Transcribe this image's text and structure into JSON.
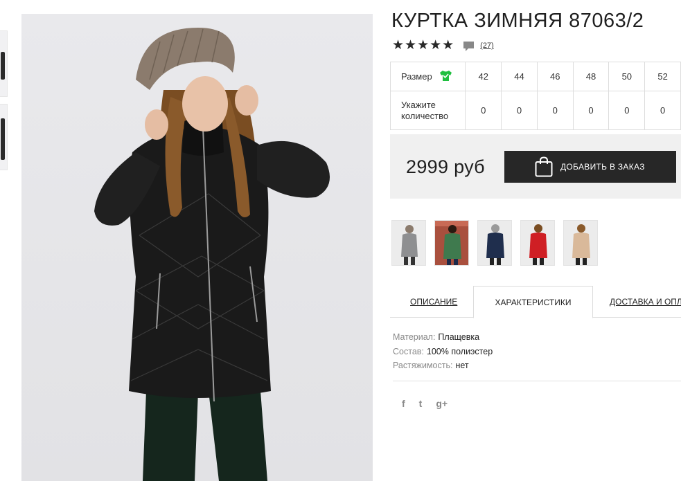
{
  "product": {
    "title": "КУРТКА ЗИМНЯЯ 87063/2",
    "rating_stars": "★★★★★",
    "review_count": "(27)"
  },
  "sizes": {
    "label": "Размер",
    "values": [
      "42",
      "44",
      "46",
      "48",
      "50",
      "52"
    ],
    "quantity_label_line1": "Укажите",
    "quantity_label_line2": "количество",
    "quantities": [
      "0",
      "0",
      "0",
      "0",
      "0",
      "0"
    ]
  },
  "purchase": {
    "price": "2999 руб",
    "add_button": "ДОБАВИТЬ В ЗАКАЗ"
  },
  "colors": [
    {
      "name": "gray",
      "coat": "#8e8f91"
    },
    {
      "name": "green",
      "coat": "#3f7a4e"
    },
    {
      "name": "navy",
      "coat": "#1f2e4d"
    },
    {
      "name": "red",
      "coat": "#cf1f24"
    },
    {
      "name": "beige",
      "coat": "#d9b99a"
    }
  ],
  "tabs": {
    "description": "ОПИСАНИЕ",
    "characteristics": "ХАРАКТЕРИСТИКИ",
    "delivery": "ДОСТАВКА И ОПЛ"
  },
  "properties": {
    "material_key": "Материал:",
    "material_value": "Плащевка",
    "composition_key": "Состав:",
    "composition_value": "100% полиэстер",
    "stretch_key": "Растяжимость:",
    "stretch_value": "нет"
  },
  "social": {
    "facebook": "f",
    "twitter": "t",
    "google": "g+"
  },
  "accent_colors": {
    "button_bg": "#272727",
    "size_icon": "#1fbf3f",
    "price_box_bg": "#f0f0f0"
  }
}
